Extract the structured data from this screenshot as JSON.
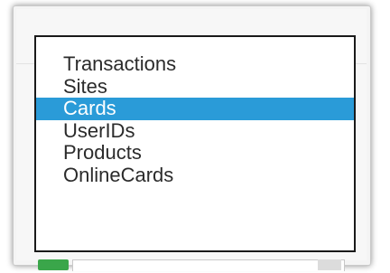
{
  "dropdown": {
    "selected_index": 2,
    "options": [
      {
        "label": "Transactions"
      },
      {
        "label": "Sites"
      },
      {
        "label": "Cards"
      },
      {
        "label": "UserIDs"
      },
      {
        "label": "Products"
      },
      {
        "label": "OnlineCards"
      }
    ]
  },
  "colors": {
    "selected_bg": "#2a9bd8",
    "selected_text": "#ffffff",
    "option_text": "#2b2b2b",
    "accent_green": "#3aa64a"
  }
}
